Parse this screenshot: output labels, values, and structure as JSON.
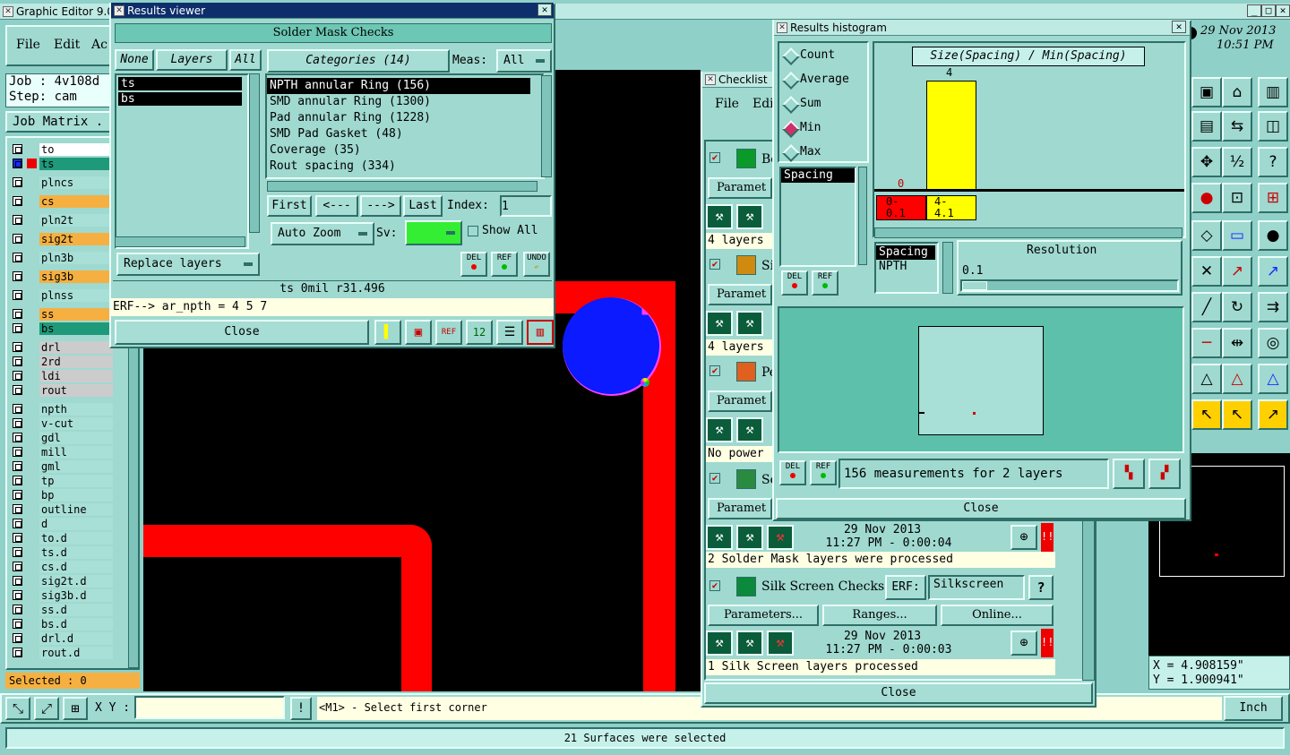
{
  "main": {
    "title": "Graphic Editor 9.0",
    "menu": [
      "File",
      "Edit",
      "Ac"
    ],
    "job_label": "Job : 4v108d",
    "step_label": "Step: cam",
    "job_matrix": "Job Matrix .",
    "layers": [
      {
        "name": "to",
        "color": "#ffffff"
      },
      {
        "name": "ts",
        "color": "#1e9a7a",
        "active": true
      },
      {
        "name": "plncs",
        "color": "#a8dfd6"
      },
      {
        "name": "cs",
        "color": "#f5b041"
      },
      {
        "name": "pln2t",
        "color": "#a8dfd6"
      },
      {
        "name": "sig2t",
        "color": "#f5b041"
      },
      {
        "name": "pln3b",
        "color": "#a8dfd6"
      },
      {
        "name": "sig3b",
        "color": "#f5b041"
      },
      {
        "name": "plnss",
        "color": "#a8dfd6"
      },
      {
        "name": "ss",
        "color": "#f5b041"
      },
      {
        "name": "bs",
        "color": "#1e9a7a"
      },
      {
        "name": "drl",
        "color": "#cccccc"
      },
      {
        "name": "2rd",
        "color": "#cccccc"
      },
      {
        "name": "ldi",
        "color": "#cccccc"
      },
      {
        "name": "rout",
        "color": "#cccccc"
      },
      {
        "name": "npth",
        "color": "#a8dfd6"
      },
      {
        "name": "v-cut",
        "color": "#a8dfd6"
      },
      {
        "name": "gdl",
        "color": "#a8dfd6"
      },
      {
        "name": "mill",
        "color": "#a8dfd6"
      },
      {
        "name": "gml",
        "color": "#a8dfd6"
      },
      {
        "name": "tp",
        "color": "#a8dfd6"
      },
      {
        "name": "bp",
        "color": "#a8dfd6"
      },
      {
        "name": "outline",
        "color": "#a8dfd6"
      },
      {
        "name": "d",
        "color": "#a8dfd6"
      },
      {
        "name": "to.d",
        "color": "#a8dfd6"
      },
      {
        "name": "ts.d",
        "color": "#a8dfd6"
      },
      {
        "name": "cs.d",
        "color": "#a8dfd6"
      },
      {
        "name": "sig2t.d",
        "color": "#a8dfd6"
      },
      {
        "name": "sig3b.d",
        "color": "#a8dfd6"
      },
      {
        "name": "ss.d",
        "color": "#a8dfd6"
      },
      {
        "name": "bs.d",
        "color": "#a8dfd6"
      },
      {
        "name": "drl.d",
        "color": "#a8dfd6"
      },
      {
        "name": "rout.d",
        "color": "#a8dfd6"
      }
    ],
    "selected": "Selected : 0",
    "xy_label": "X Y :",
    "prompt": "<M1> - Select first corner",
    "units": "Inch",
    "status": "21 Surfaces were selected",
    "date": "29 Nov 2013",
    "time": "10:51 PM",
    "coord_x": "X = 4.908159\"",
    "coord_y": "Y = 1.900941\""
  },
  "results_viewer": {
    "title": "Results viewer",
    "header": "Solder Mask Checks",
    "none_btn": "None",
    "layers_btn": "Layers",
    "all_btn": "All",
    "layer_list": [
      "ts",
      "bs"
    ],
    "categories_btn": "Categories (14)",
    "meas_label": "Meas:",
    "meas_value": "All",
    "categories": [
      "NPTH annular Ring (156)",
      "SMD annular Ring (1300)",
      "Pad annular Ring (1228)",
      "SMD Pad Gasket (48)",
      "Coverage (35)",
      "Rout spacing (334)"
    ],
    "first_btn": "First",
    "prev_btn": "<---",
    "next_btn": "--->",
    "last_btn": "Last",
    "index_label": "Index:",
    "index_value": "1",
    "replace_btn": "Replace layers",
    "autozoom_btn": "Auto Zoom",
    "sv_label": "Sv:",
    "show_all": "Show All",
    "del": "DEL",
    "ref": "REF",
    "undo": "UNDO",
    "info": "ts 0mil  r31.496",
    "erf": "ERF--> ar_npth = 4 5 7",
    "close": "Close"
  },
  "checklist": {
    "title": "Checklist",
    "menu": [
      "File",
      "Edi"
    ],
    "items": [
      {
        "name": "Bo",
        "param": "Paramet",
        "status": "4 layers"
      },
      {
        "name": "Si",
        "param": "Paramet",
        "status": "4 layers"
      },
      {
        "name": "Pe",
        "param": "Paramet",
        "status": "No power"
      },
      {
        "name": "So",
        "param": "Paramet",
        "date": "29 Nov 2013",
        "time": "11:27 PM - 0:00:04",
        "status": "2 Solder Mask layers were processed"
      },
      {
        "name": "Silk Screen Checks",
        "erf_label": "ERF:",
        "erf_value": "Silkscreen",
        "param": "Parameters...",
        "ranges": "Ranges...",
        "online": "Online...",
        "date": "29 Nov 2013",
        "time": "11:27 PM - 0:00:03",
        "status": "1 Silk Screen layers processed"
      }
    ],
    "close": "Close"
  },
  "histogram": {
    "title": "Results histogram",
    "modes": [
      "Count",
      "Average",
      "Sum",
      "Min",
      "Max"
    ],
    "selected_mode": "Min",
    "chart_title": "Size(Spacing) / Min(Spacing)",
    "bar_value": "4",
    "zero_label": "0",
    "bins": [
      "0-\n0.1",
      "4-\n4.1"
    ],
    "list": [
      "Spacing"
    ],
    "list2": [
      "Spacing",
      "NPTH"
    ],
    "resolution_label": "Resolution",
    "resolution_value": "0.1",
    "measurements": "156 measurements for 2 layers",
    "del": "DEL",
    "ref": "REF",
    "close": "Close"
  }
}
